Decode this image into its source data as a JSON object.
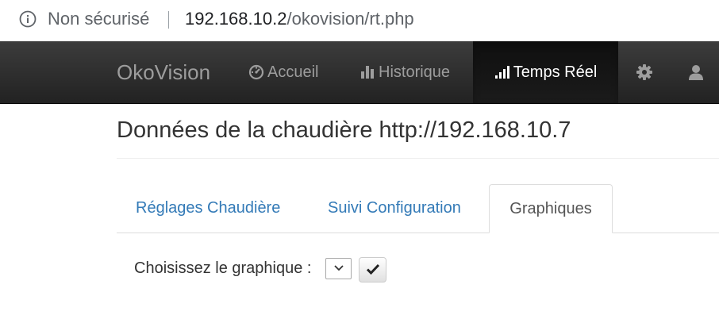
{
  "browser": {
    "security_label": "Non sécurisé",
    "url_host": "192.168.10.2",
    "url_path": "/okovision/rt.php",
    "info_icon": "info-circle-icon"
  },
  "navbar": {
    "brand": "OkoVision",
    "items": [
      {
        "label": "Accueil",
        "icon": "dashboard-icon"
      },
      {
        "label": "Historique",
        "icon": "bar-chart-icon"
      },
      {
        "label": "Temps Réel",
        "icon": "signal-icon",
        "active": true
      }
    ],
    "settings_icon": "gear-icon",
    "user_icon": "user-icon",
    "colors": {
      "background": "#222222",
      "active_text": "#ffffff",
      "text": "#9d9d9d"
    }
  },
  "main": {
    "title": "Données de la chaudière http://192.168.10.7",
    "tabs": [
      {
        "label": "Réglages Chaudière"
      },
      {
        "label": "Suivi Configuration"
      },
      {
        "label": "Graphiques",
        "active": true
      }
    ],
    "choose_label": "Choisissez le graphique :",
    "select_value": "",
    "ok_icon": "check-icon",
    "link_color": "#337ab7"
  }
}
